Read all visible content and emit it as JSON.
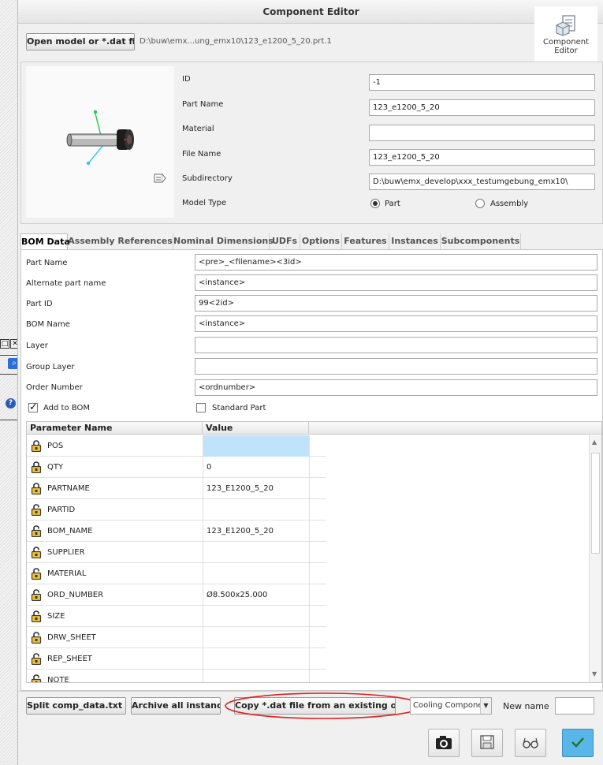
{
  "window": {
    "title": "Component Editor"
  },
  "ribbon": {
    "component_editor_label_line1": "Component",
    "component_editor_label_line2": "Editor"
  },
  "toolbar": {
    "open_model_label": "Open model or *.dat file.",
    "file_path": "D:\\buw\\emx...ung_emx10\\123_e1200_5_20.prt.1"
  },
  "properties": {
    "id_label": "ID",
    "id_value": "-1",
    "part_name_label": "Part Name",
    "part_name_value": "123_e1200_5_20",
    "material_label": "Material",
    "material_value": "",
    "file_name_label": "File Name",
    "file_name_value": "123_e1200_5_20",
    "subdirectory_label": "Subdirectory",
    "subdirectory_value": "D:\\buw\\emx_develop\\xxx_testumgebung_emx10\\",
    "model_type_label": "Model Type",
    "model_type_options": [
      "Part",
      "Assembly"
    ],
    "model_type_selected": "Part"
  },
  "tabs": [
    "BOM Data",
    "Assembly References",
    "Nominal Dimensions",
    "UDFs",
    "Options",
    "Features",
    "Instances",
    "Subcomponents"
  ],
  "active_tab": "BOM Data",
  "bom": {
    "fields": [
      {
        "label": "Part Name",
        "value": "<pre>_<filename><3id>"
      },
      {
        "label": "Alternate part name",
        "value": "<instance>"
      },
      {
        "label": "Part ID",
        "value": "99<2id>"
      },
      {
        "label": "BOM Name",
        "value": "<instance>"
      },
      {
        "label": "Layer",
        "value": ""
      },
      {
        "label": "Group Layer",
        "value": ""
      },
      {
        "label": "Order Number",
        "value": "<ordnumber>"
      }
    ],
    "add_to_bom_label": "Add to BOM",
    "add_to_bom_checked": true,
    "standard_part_label": "Standard Part",
    "standard_part_checked": false
  },
  "param_table": {
    "headers": [
      "Parameter Name",
      "Value"
    ],
    "rows": [
      {
        "name": "POS",
        "value": "",
        "locked": true
      },
      {
        "name": "QTY",
        "value": "0",
        "locked": true
      },
      {
        "name": "PARTNAME",
        "value": "123_E1200_5_20",
        "locked": true
      },
      {
        "name": "PARTID",
        "value": "",
        "locked": false
      },
      {
        "name": "BOM_NAME",
        "value": "123_E1200_5_20",
        "locked": false
      },
      {
        "name": "SUPPLIER",
        "value": "",
        "locked": false
      },
      {
        "name": "MATERIAL",
        "value": "",
        "locked": false
      },
      {
        "name": "ORD_NUMBER",
        "value": "Ø8.500x25.000",
        "locked": false
      },
      {
        "name": "SIZE",
        "value": "",
        "locked": false
      },
      {
        "name": "DRW_SHEET",
        "value": "",
        "locked": false
      },
      {
        "name": "REP_SHEET",
        "value": "",
        "locked": false
      },
      {
        "name": "NOTE",
        "value": "",
        "locked": false
      }
    ]
  },
  "bottom": {
    "split_label": "Split comp_data.txt file",
    "archive_label": "Archive all instances",
    "copy_label": "Copy *.dat file from an existing one.",
    "dropdown_value": "Cooling Componei",
    "new_name_label": "New name",
    "new_name_value": ""
  },
  "colors": {
    "accept_button": "#5ab6e8",
    "highlight_cell": "#bfe3fb",
    "annotation_ellipse": "#e02020"
  }
}
